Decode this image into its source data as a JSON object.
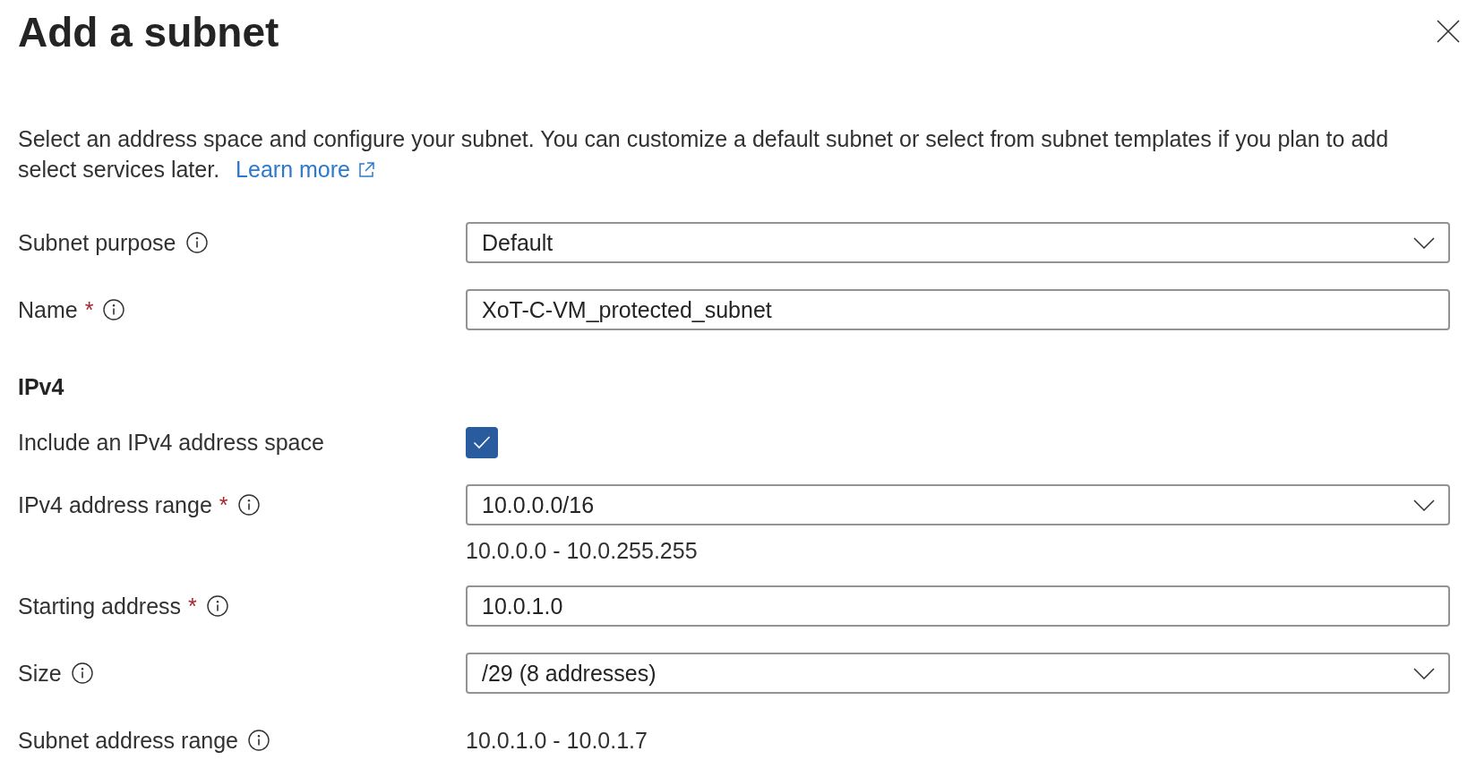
{
  "panel": {
    "title": "Add a subnet"
  },
  "intro": {
    "text": "Select an address space and configure your subnet. You can customize a default subnet or select from subnet templates if you plan to add select services later.",
    "link": "Learn more"
  },
  "fields": [
    {
      "kind": "dropdown",
      "label": "Subnet purpose",
      "info": true,
      "value": "Default"
    },
    {
      "kind": "textbox",
      "label": "Name",
      "required_mark": "*",
      "info": true,
      "value": "XoT-C-VM_protected_subnet"
    },
    {
      "kind": "heading",
      "label": "IPv4"
    },
    {
      "kind": "checkbox",
      "label": "Include an IPv4 address space",
      "checked": true
    },
    {
      "kind": "dropdown",
      "label": "IPv4 address range",
      "required_mark": "*",
      "info": true,
      "value": "10.0.0.0/16",
      "hint": "10.0.0.0 - 10.0.255.255"
    },
    {
      "kind": "textbox",
      "label": "Starting address",
      "required_mark": "*",
      "info": true,
      "value": "10.0.1.0"
    },
    {
      "kind": "dropdown",
      "label": "Size",
      "info": true,
      "value": "/29 (8 addresses)"
    },
    {
      "kind": "readonly",
      "label": "Subnet address range",
      "info": true,
      "value": "10.0.1.0 - 10.0.1.7"
    }
  ]
}
